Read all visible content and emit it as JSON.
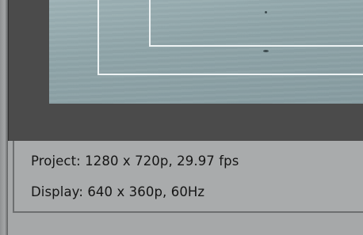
{
  "monitor": {
    "info": {
      "project_text": "Project: 1280 x 720p, 29.97 fps",
      "display_text": "Display: 640 x 360p, 60Hz"
    }
  }
}
